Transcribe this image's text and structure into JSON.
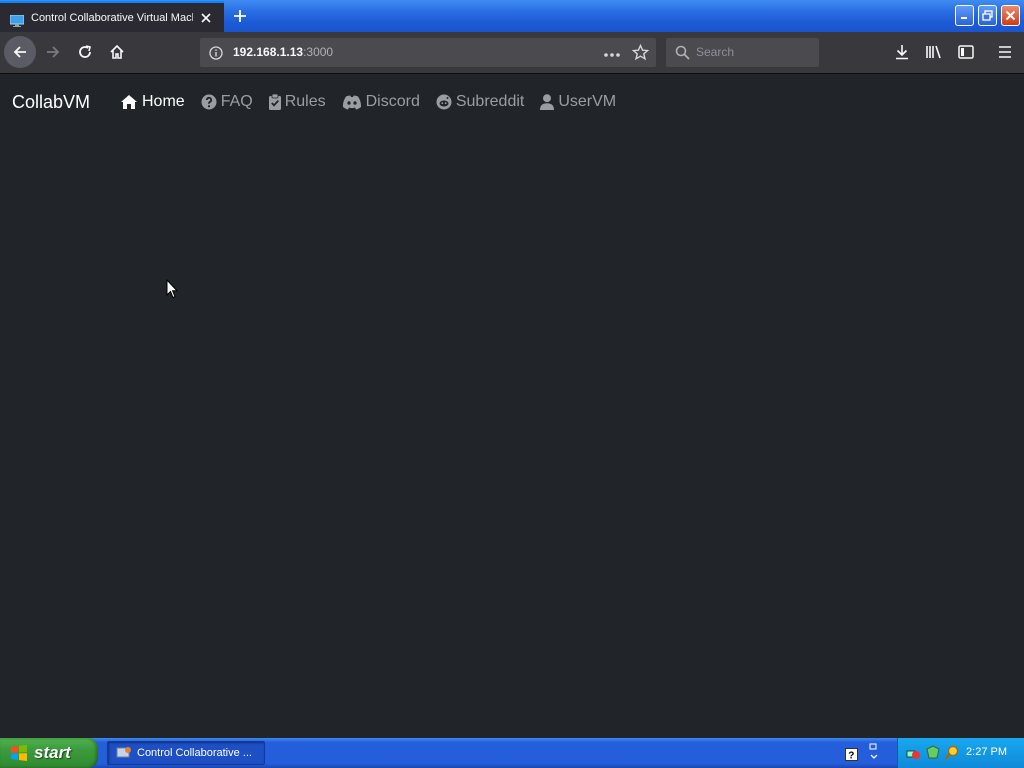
{
  "browser": {
    "tab_title": "Control Collaborative Virtual Machi",
    "url_host": "192.168.1.13",
    "url_port": ":3000",
    "search_placeholder": "Search"
  },
  "site": {
    "brand": "CollabVM",
    "nav": [
      {
        "label": "Home",
        "icon": "home-icon",
        "active": true
      },
      {
        "label": "FAQ",
        "icon": "question-circle-icon",
        "active": false
      },
      {
        "label": "Rules",
        "icon": "clipboard-check-icon",
        "active": false
      },
      {
        "label": "Discord",
        "icon": "discord-icon",
        "active": false
      },
      {
        "label": "Subreddit",
        "icon": "reddit-icon",
        "active": false
      },
      {
        "label": "UserVM",
        "icon": "user-icon",
        "active": false
      }
    ]
  },
  "taskbar": {
    "start_label": "start",
    "task_label": "Control Collaborative ...",
    "clock": "2:27 PM"
  },
  "colors": {
    "page_bg": "#212529",
    "toolbar_bg": "#38383d",
    "tab_accent": "#0a84ff",
    "xp_blue": "#245edb",
    "start_green": "#3c9a3c"
  }
}
